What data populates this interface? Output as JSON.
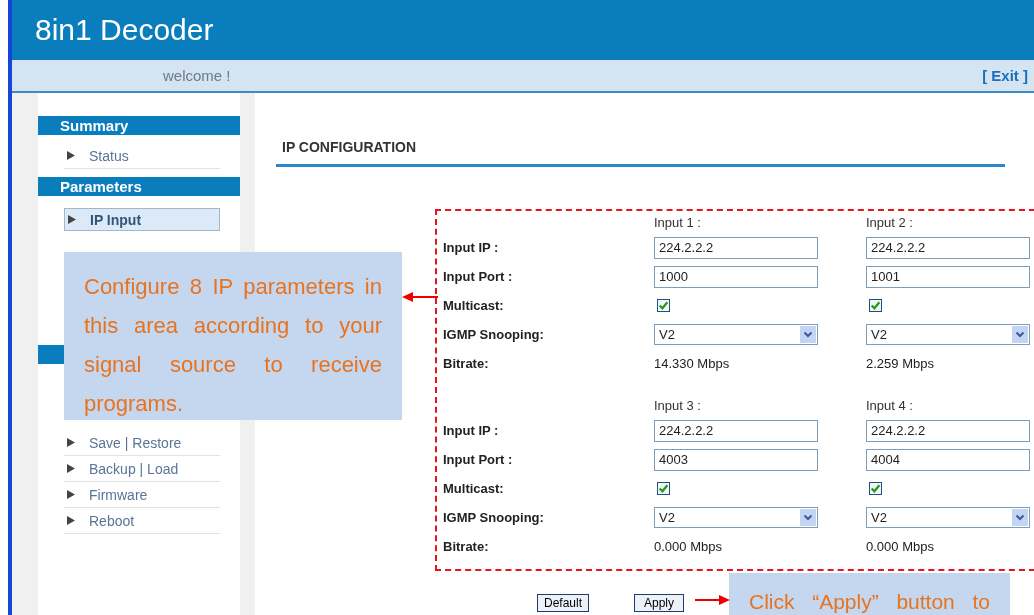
{
  "header": {
    "title": "8in1 Decoder"
  },
  "welcome_bar": {
    "welcome": "welcome !",
    "exit_link": "[ Exit ]"
  },
  "sidebar": {
    "sections": [
      {
        "heading": "Summary",
        "items": [
          {
            "label": "Status",
            "selected": false
          }
        ]
      },
      {
        "heading": "Parameters",
        "items": [
          {
            "label": "IP Input",
            "selected": true
          }
        ]
      },
      {
        "items": [
          {
            "label": "Save | Restore",
            "selected": false
          },
          {
            "label": "Backup | Load",
            "selected": false
          },
          {
            "label": "Firmware",
            "selected": false
          },
          {
            "label": "Reboot",
            "selected": false
          }
        ]
      }
    ]
  },
  "page_title": "IP CONFIGURATION",
  "input_groups": [
    {
      "labels": [
        "Input IP :",
        "Input Port :",
        "Multicast:",
        "IGMP Snooping:",
        "Bitrate:"
      ],
      "inputs": [
        {
          "header": "Input 1 :",
          "ip": "224.2.2.2",
          "port": "1000",
          "multicast": true,
          "igmp": "V2",
          "bitrate": "14.330 Mbps"
        },
        {
          "header": "Input 2 :",
          "ip": "224.2.2.2",
          "port": "1001",
          "multicast": true,
          "igmp": "V2",
          "bitrate": "2.259 Mbps"
        }
      ]
    },
    {
      "labels": [
        "Input IP :",
        "Input Port :",
        "Multicast:",
        "IGMP Snooping:",
        "Bitrate:"
      ],
      "inputs": [
        {
          "header": "Input 3 :",
          "ip": "224.2.2.2",
          "port": "4003",
          "multicast": true,
          "igmp": "V2",
          "bitrate": "0.000 Mbps"
        },
        {
          "header": "Input 4 :",
          "ip": "224.2.2.2",
          "port": "4004",
          "multicast": true,
          "igmp": "V2",
          "bitrate": "0.000 Mbps"
        }
      ]
    }
  ],
  "buttons": [
    "Default",
    "Apply"
  ],
  "callouts": [
    {
      "kind": "area",
      "text": "Configure 8 IP parameters in this area according to your signal source to receive programs."
    },
    {
      "kind": "apply",
      "text": "Click “Apply” button to"
    }
  ]
}
